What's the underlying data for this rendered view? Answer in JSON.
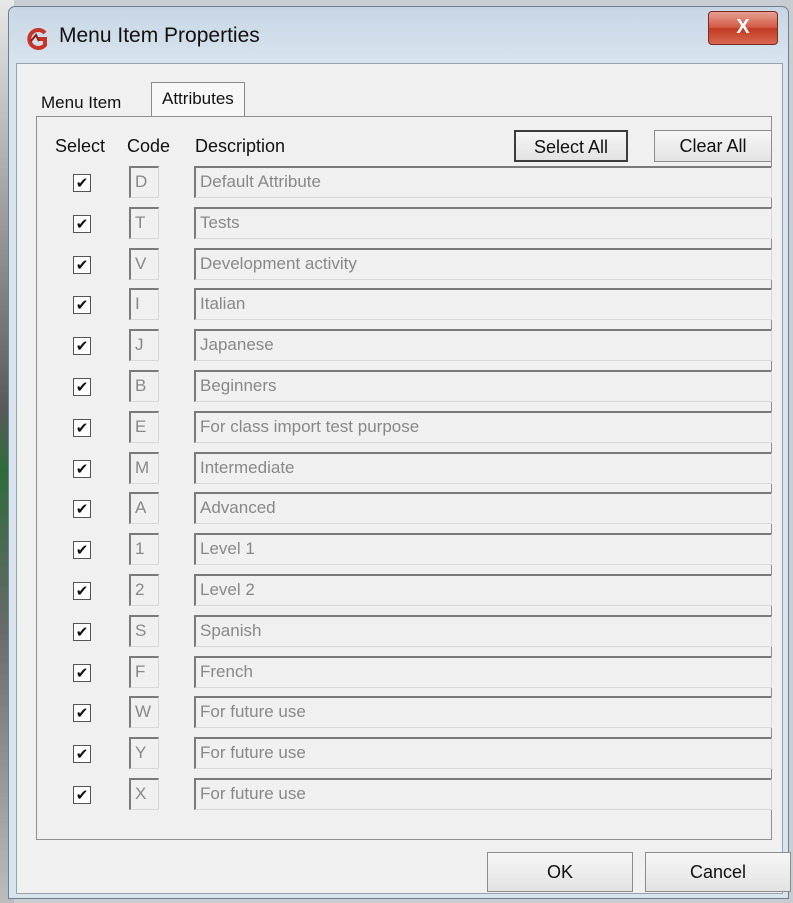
{
  "window": {
    "title": "Menu Item Properties",
    "close_label": "X",
    "icon": "app-logo-icon",
    "accent_color": "#c8342a"
  },
  "tabs": [
    {
      "label": "Menu Item",
      "active": false
    },
    {
      "label": "Attributes",
      "active": true
    }
  ],
  "headers": {
    "select": "Select",
    "code": "Code",
    "description": "Description"
  },
  "buttons": {
    "select_all": "Select All",
    "clear_all": "Clear All",
    "ok": "OK",
    "cancel": "Cancel"
  },
  "rows": [
    {
      "checked": true,
      "code": "D",
      "description": "Default Attribute"
    },
    {
      "checked": true,
      "code": "T",
      "description": "Tests"
    },
    {
      "checked": true,
      "code": "V",
      "description": "Development activity"
    },
    {
      "checked": true,
      "code": "I",
      "description": "Italian"
    },
    {
      "checked": true,
      "code": "J",
      "description": "Japanese"
    },
    {
      "checked": true,
      "code": "B",
      "description": "Beginners"
    },
    {
      "checked": true,
      "code": "E",
      "description": "For class import test purpose"
    },
    {
      "checked": true,
      "code": "M",
      "description": "Intermediate"
    },
    {
      "checked": true,
      "code": "A",
      "description": "Advanced"
    },
    {
      "checked": true,
      "code": "1",
      "description": "Level 1"
    },
    {
      "checked": true,
      "code": "2",
      "description": "Level 2"
    },
    {
      "checked": true,
      "code": "S",
      "description": "Spanish"
    },
    {
      "checked": true,
      "code": "F",
      "description": "French"
    },
    {
      "checked": true,
      "code": "W",
      "description": "For future use"
    },
    {
      "checked": true,
      "code": "Y",
      "description": "For future use"
    },
    {
      "checked": true,
      "code": "X",
      "description": "For future use"
    }
  ]
}
